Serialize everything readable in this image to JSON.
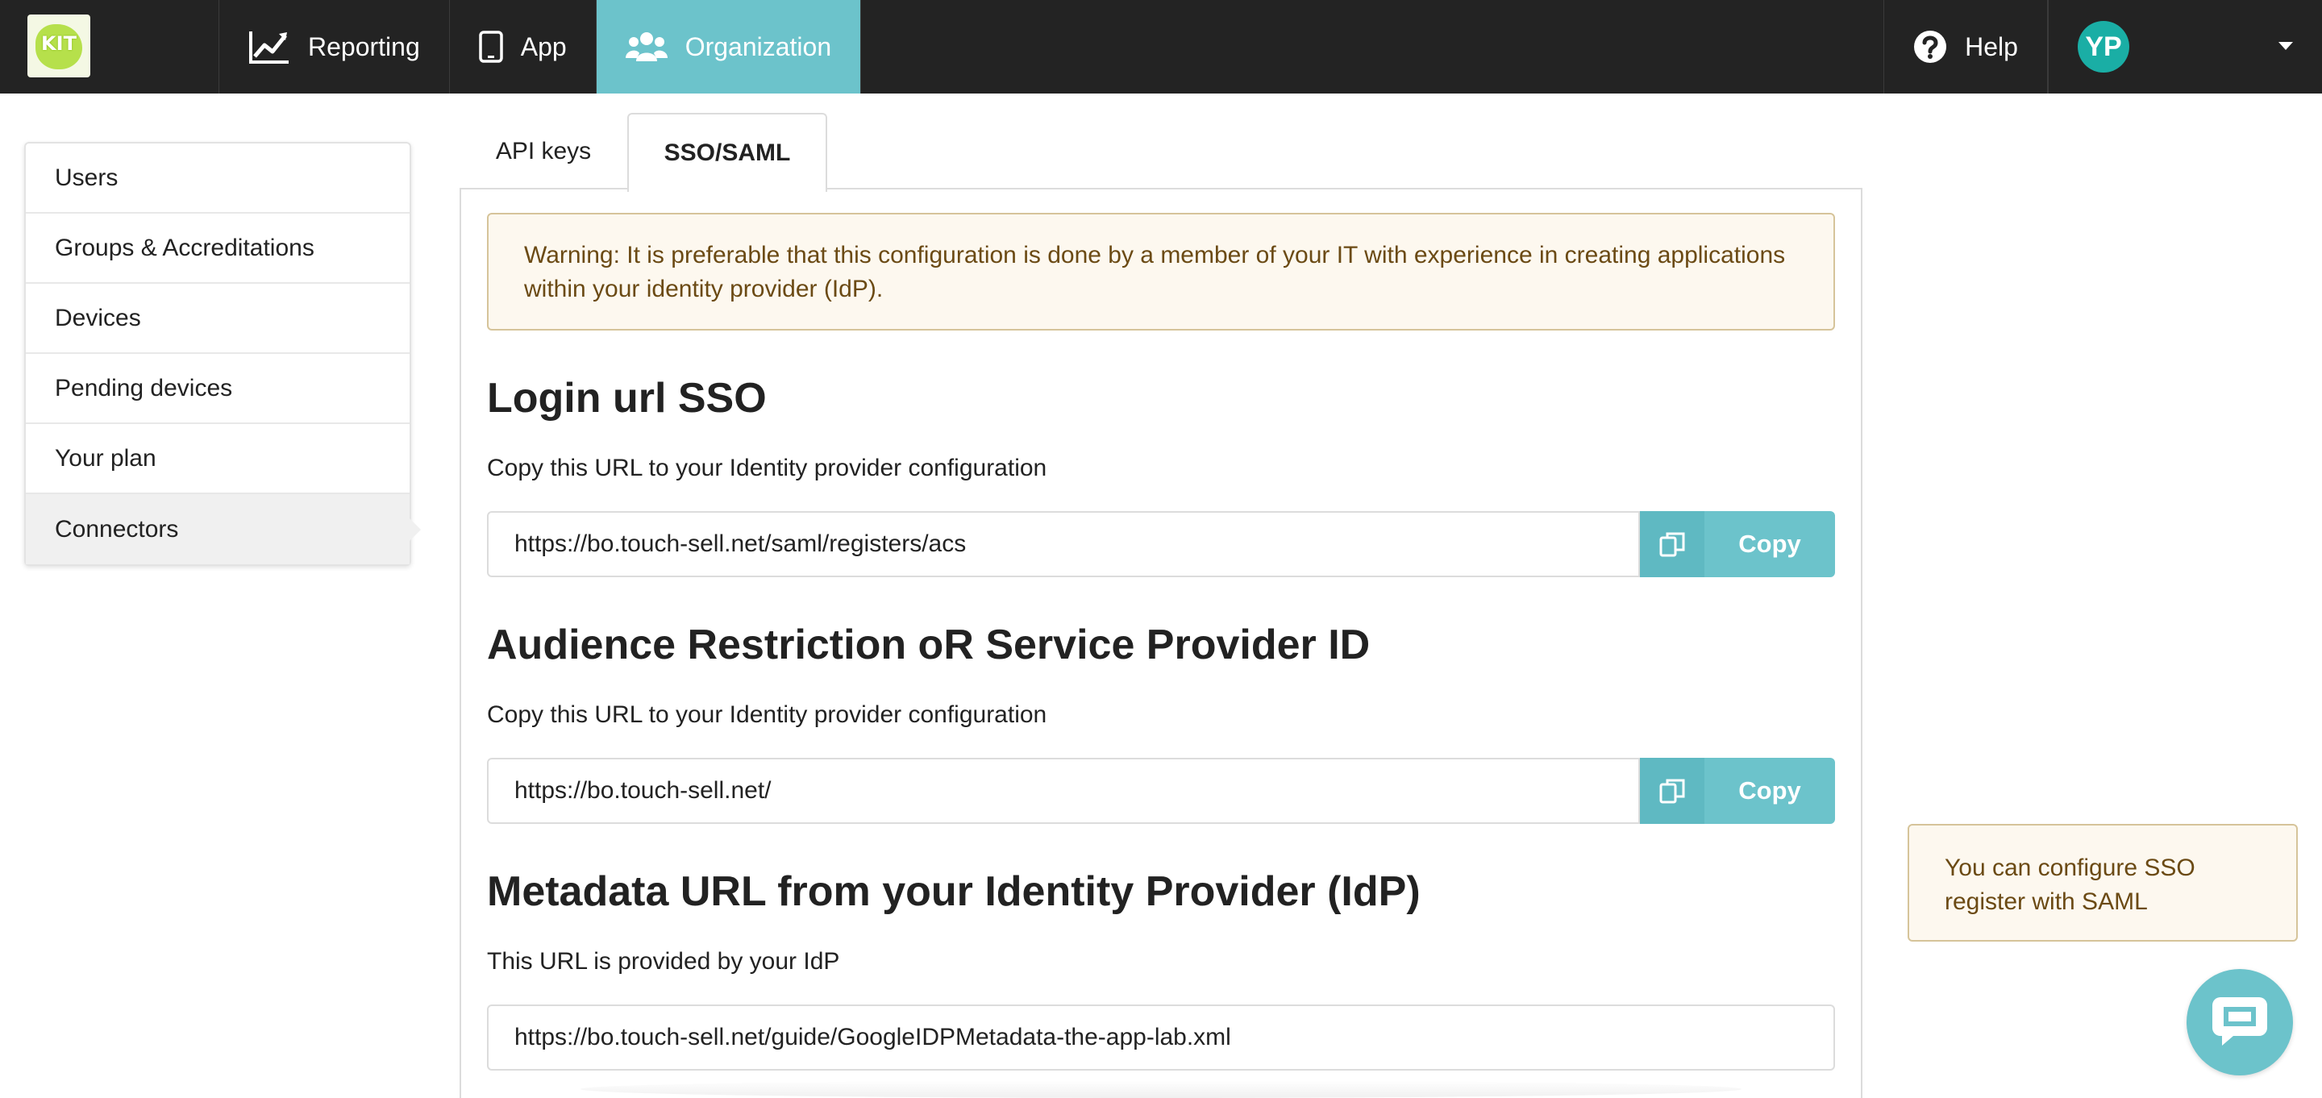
{
  "brand": {
    "logo_text": "KIT"
  },
  "nav": {
    "items": [
      {
        "label": "Reporting",
        "icon": "chart-line-icon"
      },
      {
        "label": "App",
        "icon": "tablet-icon"
      },
      {
        "label": "Organization",
        "icon": "users-icon",
        "active": true
      }
    ],
    "help_label": "Help",
    "user_initials": "YP"
  },
  "sidebar": {
    "items": [
      {
        "label": "Users"
      },
      {
        "label": "Groups & Accreditations"
      },
      {
        "label": "Devices"
      },
      {
        "label": "Pending devices"
      },
      {
        "label": "Your plan"
      },
      {
        "label": "Connectors",
        "active": true
      }
    ]
  },
  "tabs": [
    {
      "label": "API keys"
    },
    {
      "label": "SSO/SAML",
      "active": true
    }
  ],
  "warning": "Warning: It is preferable that this configuration is done by a member of your IT with experience in creating applications within your identity provider (IdP).",
  "sections": [
    {
      "title": "Login url SSO",
      "description": "Copy this URL to your Identity provider configuration",
      "value": "https://bo.touch-sell.net/saml/registers/acs",
      "copy_label": "Copy"
    },
    {
      "title": "Audience Restriction oR Service Provider ID",
      "description": "Copy this URL to your Identity provider configuration",
      "value": "https://bo.touch-sell.net/",
      "copy_label": "Copy"
    },
    {
      "title": "Metadata URL from your Identity Provider (IdP)",
      "description": "This URL is provided by your IdP",
      "value": "https://bo.touch-sell.net/guide/GoogleIDPMetadata-the-app-lab.xml"
    }
  ],
  "tip": "You can configure SSO register with SAML",
  "colors": {
    "accent": "#6cc3cb",
    "nav_bg": "#232323",
    "avatar": "#1aaea5",
    "warning_bg": "#fdf8ef",
    "warning_text": "#6b4a14"
  }
}
